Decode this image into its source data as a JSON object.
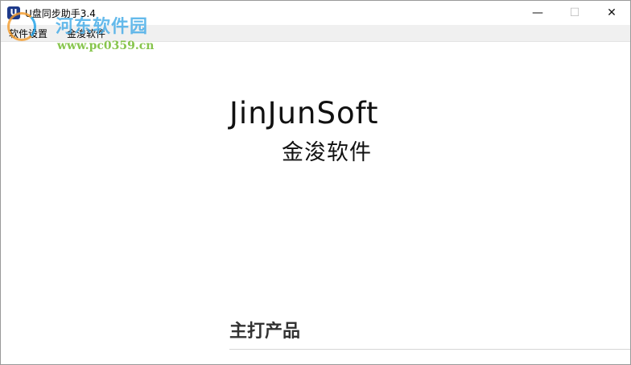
{
  "window": {
    "title": "U盘同步助手3.4",
    "app_icon_glyph": "U",
    "controls": {
      "minimize": "—",
      "maximize": "☐",
      "close": "✕"
    }
  },
  "menu": {
    "items": [
      "软件设置",
      "金浚软件"
    ]
  },
  "watermark": {
    "title": "河东软件园",
    "url": "www.pc0359.cn"
  },
  "content": {
    "brand_en": "JinJunSoft",
    "brand_cn": "金浚软件",
    "section_title": "主打产品"
  },
  "colors": {
    "accent": "#1e3a8a",
    "watermark_blue": "#4aaee8",
    "watermark_green": "#7bbf3a"
  }
}
